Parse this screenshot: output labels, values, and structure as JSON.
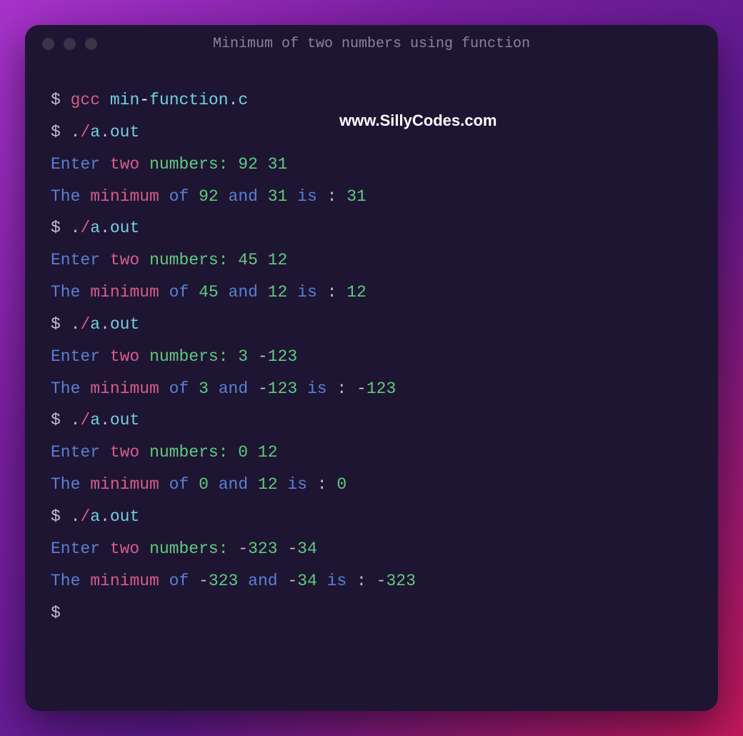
{
  "window": {
    "title": "Minimum of two numbers using function"
  },
  "watermark": "www.SillyCodes.com",
  "prompt": "$",
  "commands": {
    "compile": {
      "gcc": "gcc",
      "file1": "min",
      "dash": "-",
      "file2": "function",
      "dot": ".",
      "ext": "c"
    },
    "run": {
      "dot1": ".",
      "slash": "/",
      "a": "a",
      "dot2": ".",
      "out": "out"
    }
  },
  "labels": {
    "enter": "Enter",
    "two": "two",
    "numbers": "numbers:",
    "the": "The",
    "minimum": "minimum",
    "of": "of",
    "and": "and",
    "is": "is",
    "colon": ":"
  },
  "runs": [
    {
      "a": "92",
      "b": "31",
      "min": "31",
      "a_neg": false,
      "b_neg": false,
      "min_neg": false
    },
    {
      "a": "45",
      "b": "12",
      "min": "12",
      "a_neg": false,
      "b_neg": false,
      "min_neg": false
    },
    {
      "a": "3",
      "b": "123",
      "min": "123",
      "a_neg": false,
      "b_neg": true,
      "min_neg": true
    },
    {
      "a": "0",
      "b": "12",
      "min": "0",
      "a_neg": false,
      "b_neg": false,
      "min_neg": false
    },
    {
      "a": "323",
      "b": "34",
      "min": "323",
      "a_neg": true,
      "b_neg": true,
      "min_neg": true
    }
  ]
}
